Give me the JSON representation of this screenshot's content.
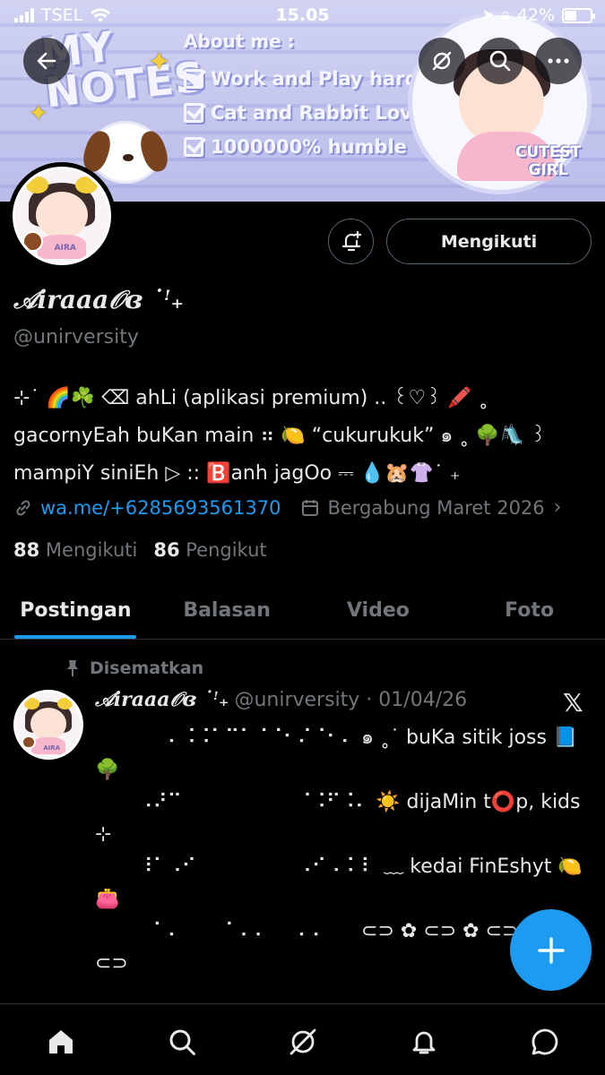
{
  "status_bar": {
    "carrier": "TSEL",
    "time": "15.05",
    "battery": "42%",
    "battery_level": 0.42
  },
  "banner": {
    "title": "MY NOTES",
    "about_heading": "About me :",
    "about_items": [
      "Work and Play hard",
      "Cat and Rabbit Lovers",
      "1000000% humble"
    ],
    "badge": "CUTEST GIRL",
    "avatar_tag": "AIRA",
    "colors": {
      "stripe_light": "#c9cbf0",
      "stripe_dark": "#b5b8e8"
    }
  },
  "header_buttons": {
    "back": "back-arrow-icon",
    "grok": "grok-icon",
    "search": "search-icon",
    "more": "more-dots-icon"
  },
  "profile": {
    "name": "𝒜iraaa𝒪ɞ ˙ꜝ₊",
    "handle": "@unirversity",
    "follow_button": "Mengikuti",
    "bio": [
      "⊹˙ 🌈☘️ ⌫ ahLi (aplikasi premium) .. ꒰♡꒱ 🖍️ ˳",
      "gacornyEah buKan main ⠶ 🍋 “cukurukuk” ๑ ˳ 🌳🛝 ꒱",
      "mampiY siniEh ▷ :: 🅱️anh jagOo ⎓ 💧🐹👚˙ ₊"
    ],
    "link": "wa.me/+6285693561370",
    "joined": "Bergabung Maret 2026",
    "following_count": "88",
    "following_label": "Mengikuti",
    "followers_count": "86",
    "followers_label": "Pengikut"
  },
  "tabs": [
    "Postingan",
    "Balasan",
    "Video",
    "Foto"
  ],
  "active_tab": "Postingan",
  "pinned_post": {
    "pinned_label": "Disematkan",
    "author": "𝒜iraaa𝒪ɞ ˙ꜝ₊",
    "meta": "@unirversity · 01/04/26",
    "lines": [
      "⠀⠀⠀⠀⠀⠄⠨⠨⠁⠉⠁⠈⠈⠂⠌⠈⠂⠄ ๑ ˳˙ buKa sitik joss 📘",
      "🌳",
      "⠀⠀⠀⠠⠜⠉⠀⠀⠀⠀⠀⠀⠀⠀⠈⠨⠋⠨⠄ ☀️ dijaMin t⭕p, kids",
      "⊹",
      "⠀⠀⠀⠸⠁⠠⠊⠀⠀⠀⠀⠀⠀⠀⠠⠊⠠⠨⠸⠀﹏ kedai FinEshyt 🍋",
      "👛",
      "⠀⠀⠀⠀⠁⠄⠀⠀⠀⠁⠄⠄⠀⠀⠄⠄⠀⠀ ⊂⊃ ✿ ⊂⊃ ✿ ⊂⊃ ✿",
      "⊂⊃"
    ]
  },
  "bottom_nav": [
    "home-icon",
    "search-icon",
    "grok-icon",
    "notifications-icon",
    "messages-icon"
  ],
  "accent_color": "#1d9bf0"
}
